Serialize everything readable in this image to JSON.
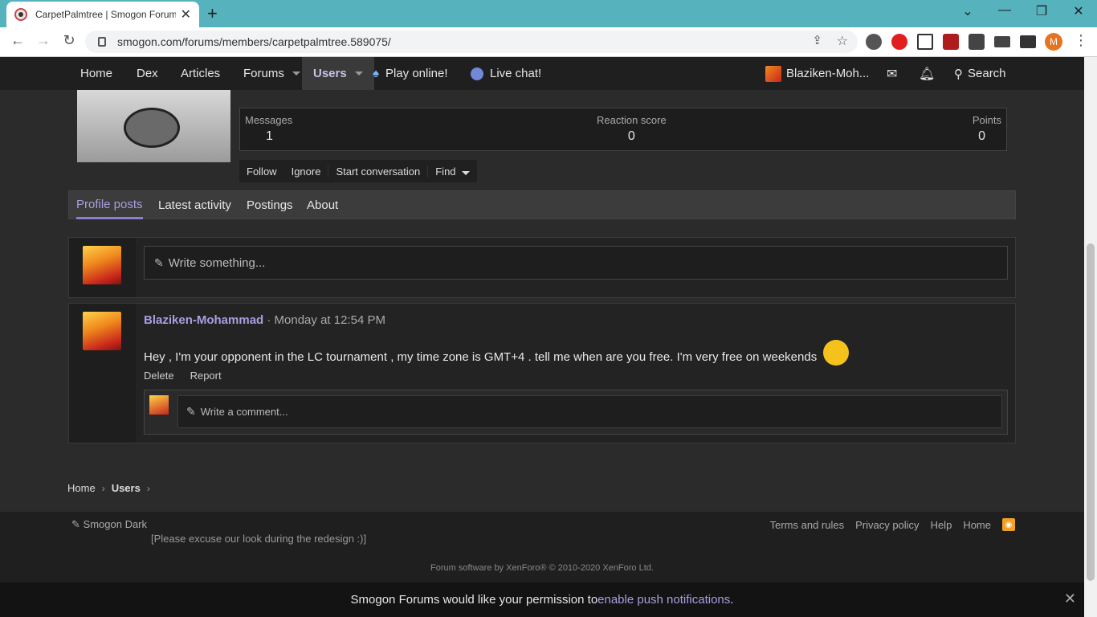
{
  "browser": {
    "tab_title": "CarpetPalmtree | Smogon Forum",
    "tab_close": "✕",
    "new_tab": "+",
    "url": "smogon.com/forums/members/carpetpalmtree.589075/",
    "profile_initial": "M",
    "minimize": "⌄",
    "maximize": "—",
    "restore": "❐",
    "close": "✕"
  },
  "nav": {
    "home": "Home",
    "dex": "Dex",
    "articles": "Articles",
    "forums": "Forums",
    "users": "Users",
    "play_online": "Play online!",
    "live_chat": "Live chat!",
    "account": "Blaziken-Moh...",
    "search": "Search"
  },
  "profile": {
    "stats": [
      {
        "label": "Messages",
        "value": "1"
      },
      {
        "label": "Reaction score",
        "value": "0"
      },
      {
        "label": "Points",
        "value": "0"
      }
    ],
    "actions": [
      "Follow",
      "Ignore",
      "Start conversation",
      "Find"
    ]
  },
  "tabs": [
    "Profile posts",
    "Latest activity",
    "Postings",
    "About"
  ],
  "write_placeholder": "Write something...",
  "post": {
    "author": "Blaziken-Mohammad",
    "time": "· Monday at 12:54 PM",
    "text": "Hey , I'm your opponent in the LC tournament , my time zone is GMT+4 . tell me when are you free. I'm very free on weekends",
    "actions": [
      "Delete",
      "Report"
    ],
    "comment_placeholder": "Write a comment..."
  },
  "breadcrumb": [
    "Home",
    "Users"
  ],
  "footer": {
    "style": "Smogon Dark",
    "note": "[Please excuse our look during the redesign :)]",
    "links": [
      "Terms and rules",
      "Privacy policy",
      "Help",
      "Home"
    ],
    "copyright": "Forum software by XenForo® © 2010-2020 XenForo Ltd."
  },
  "push": {
    "prefix": "Smogon Forums would like your permission to ",
    "link": "enable push notifications",
    "suffix": "."
  },
  "colors": {
    "accent": "#a99ee0",
    "tabbar": "#56b3bd",
    "rss": "#f0a024"
  }
}
